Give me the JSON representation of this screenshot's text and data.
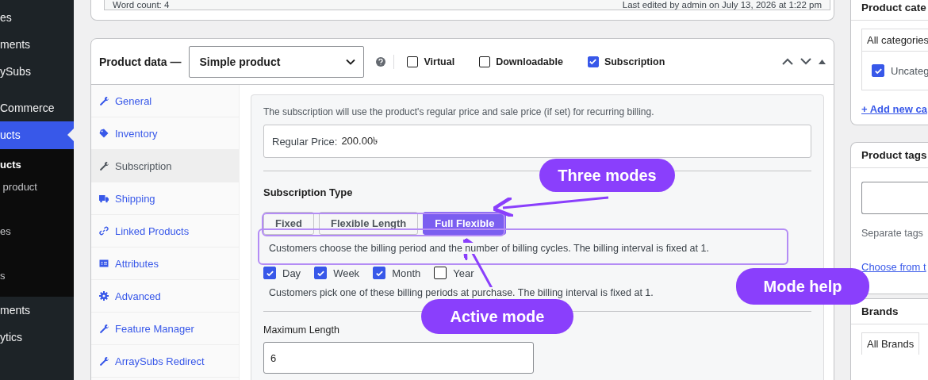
{
  "admin_menu": {
    "items": [
      {
        "label": "es",
        "kind": "item",
        "selected": false
      },
      {
        "label": "ments",
        "kind": "item",
        "selected": false
      },
      {
        "label": "ySubs",
        "kind": "item",
        "selected": false
      },
      {
        "label": "Commerce",
        "kind": "item",
        "selected": false
      },
      {
        "label": "ucts",
        "kind": "item",
        "selected": true
      },
      {
        "label": "ucts",
        "kind": "sub",
        "selected": true
      },
      {
        "label": " product",
        "kind": "sub",
        "selected": false
      },
      {
        "label": "es",
        "kind": "sub",
        "selected": false
      },
      {
        "label": "s",
        "kind": "sub",
        "selected": false
      },
      {
        "label": "ments",
        "kind": "item",
        "selected": false
      },
      {
        "label": "ytics",
        "kind": "item",
        "selected": false
      }
    ]
  },
  "editor_status": {
    "word_count": "Word count: 4",
    "last_edited": "Last edited by admin on July 13, 2026 at 1:22 pm"
  },
  "product_data": {
    "title": "Product data —",
    "product_type": "Simple product",
    "options": [
      {
        "label": "Virtual",
        "checked": false
      },
      {
        "label": "Downloadable",
        "checked": false
      },
      {
        "label": "Subscription",
        "checked": true
      }
    ],
    "tabs": [
      {
        "label": "General",
        "kind": "wrench",
        "selected": false
      },
      {
        "label": "Inventory",
        "kind": "tag",
        "selected": false
      },
      {
        "label": "Subscription",
        "kind": "wrench",
        "selected": true
      },
      {
        "label": "Shipping",
        "kind": "truck",
        "selected": false
      },
      {
        "label": "Linked Products",
        "kind": "link",
        "selected": false
      },
      {
        "label": "Attributes",
        "kind": "card",
        "selected": false
      },
      {
        "label": "Advanced",
        "kind": "gear",
        "selected": false
      },
      {
        "label": "Feature Manager",
        "kind": "wrench",
        "selected": false
      },
      {
        "label": "ArraySubs Redirect",
        "kind": "wrench",
        "selected": false
      }
    ],
    "subscription": {
      "note": "The subscription will use the product's regular price and sale price (if set) for recurring billing.",
      "price_label": "Regular Price:",
      "price_value": "200.00৳",
      "type_label": "Subscription Type",
      "modes": [
        {
          "label": "Fixed",
          "selected": false
        },
        {
          "label": "Flexible Length",
          "selected": false
        },
        {
          "label": "Full Flexible",
          "selected": true
        }
      ],
      "mode_help": "Customers choose the billing period and the number of billing cycles. The billing interval is fixed at 1.",
      "periods": [
        {
          "label": "Day",
          "checked": true
        },
        {
          "label": "Week",
          "checked": true
        },
        {
          "label": "Month",
          "checked": true
        },
        {
          "label": "Year",
          "checked": false
        }
      ],
      "periods_help": "Customers pick one of these billing periods at purchase. The billing interval is fixed at 1.",
      "max_length_label": "Maximum Length",
      "max_length_value": "6"
    }
  },
  "side": {
    "categories": {
      "title": "Product cate",
      "tab": "All categories",
      "items": [
        {
          "label": "Uncateg",
          "checked": true
        }
      ],
      "add_link": "+ Add new ca"
    },
    "tags": {
      "title": "Product tags",
      "help": "Separate tags",
      "choose_link": "Choose from t"
    },
    "brands": {
      "title": "Brands",
      "tab": "All Brands"
    }
  },
  "annotations": [
    {
      "text": "Three modes"
    },
    {
      "text": "Active mode"
    },
    {
      "text": "Mode help"
    }
  ]
}
